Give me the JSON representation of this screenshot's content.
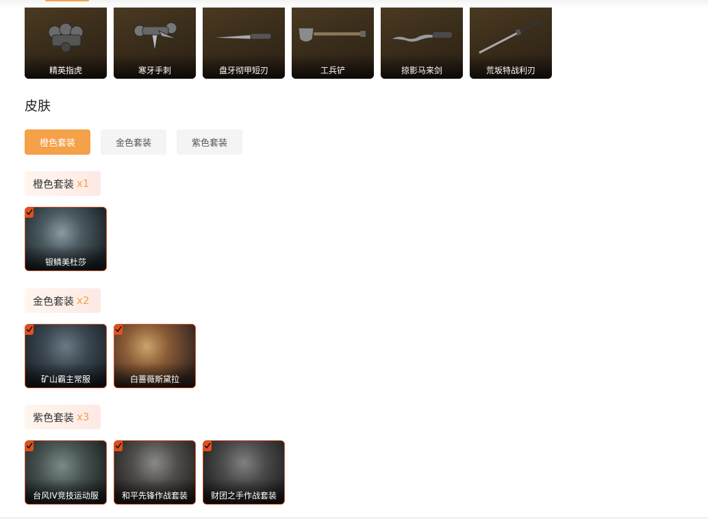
{
  "weapons": [
    {
      "label": "精英指虎",
      "icon": "knuckles-icon"
    },
    {
      "label": "寒牙手刺",
      "icon": "push-dagger-icon"
    },
    {
      "label": "盘牙彻甲短刃",
      "icon": "short-blade-icon"
    },
    {
      "label": "工兵铲",
      "icon": "shovel-icon"
    },
    {
      "label": "掠影马来剑",
      "icon": "kris-sword-icon"
    },
    {
      "label": "荒坂特战利刃",
      "icon": "katana-icon"
    }
  ],
  "skins": {
    "title": "皮肤",
    "tabs": [
      "橙色套装",
      "金色套装",
      "紫色套装"
    ],
    "active_tab": 0,
    "groups": [
      {
        "name": "橙色套装",
        "count": "x1",
        "items": [
          {
            "label": "银鳞美杜莎"
          }
        ]
      },
      {
        "name": "金色套装",
        "count": "x2",
        "items": [
          {
            "label": "矿山霸主常服"
          },
          {
            "label": "白蔷薇斯黛拉"
          }
        ]
      },
      {
        "name": "紫色套装",
        "count": "x3",
        "items": [
          {
            "label": "台风IV竞技运动服"
          },
          {
            "label": "和平先锋作战套装"
          },
          {
            "label": "财团之手作战套装"
          }
        ]
      }
    ]
  },
  "colors": {
    "accent": "#f4a14a",
    "check": "#e2501c",
    "card_border": "#d5562a"
  }
}
